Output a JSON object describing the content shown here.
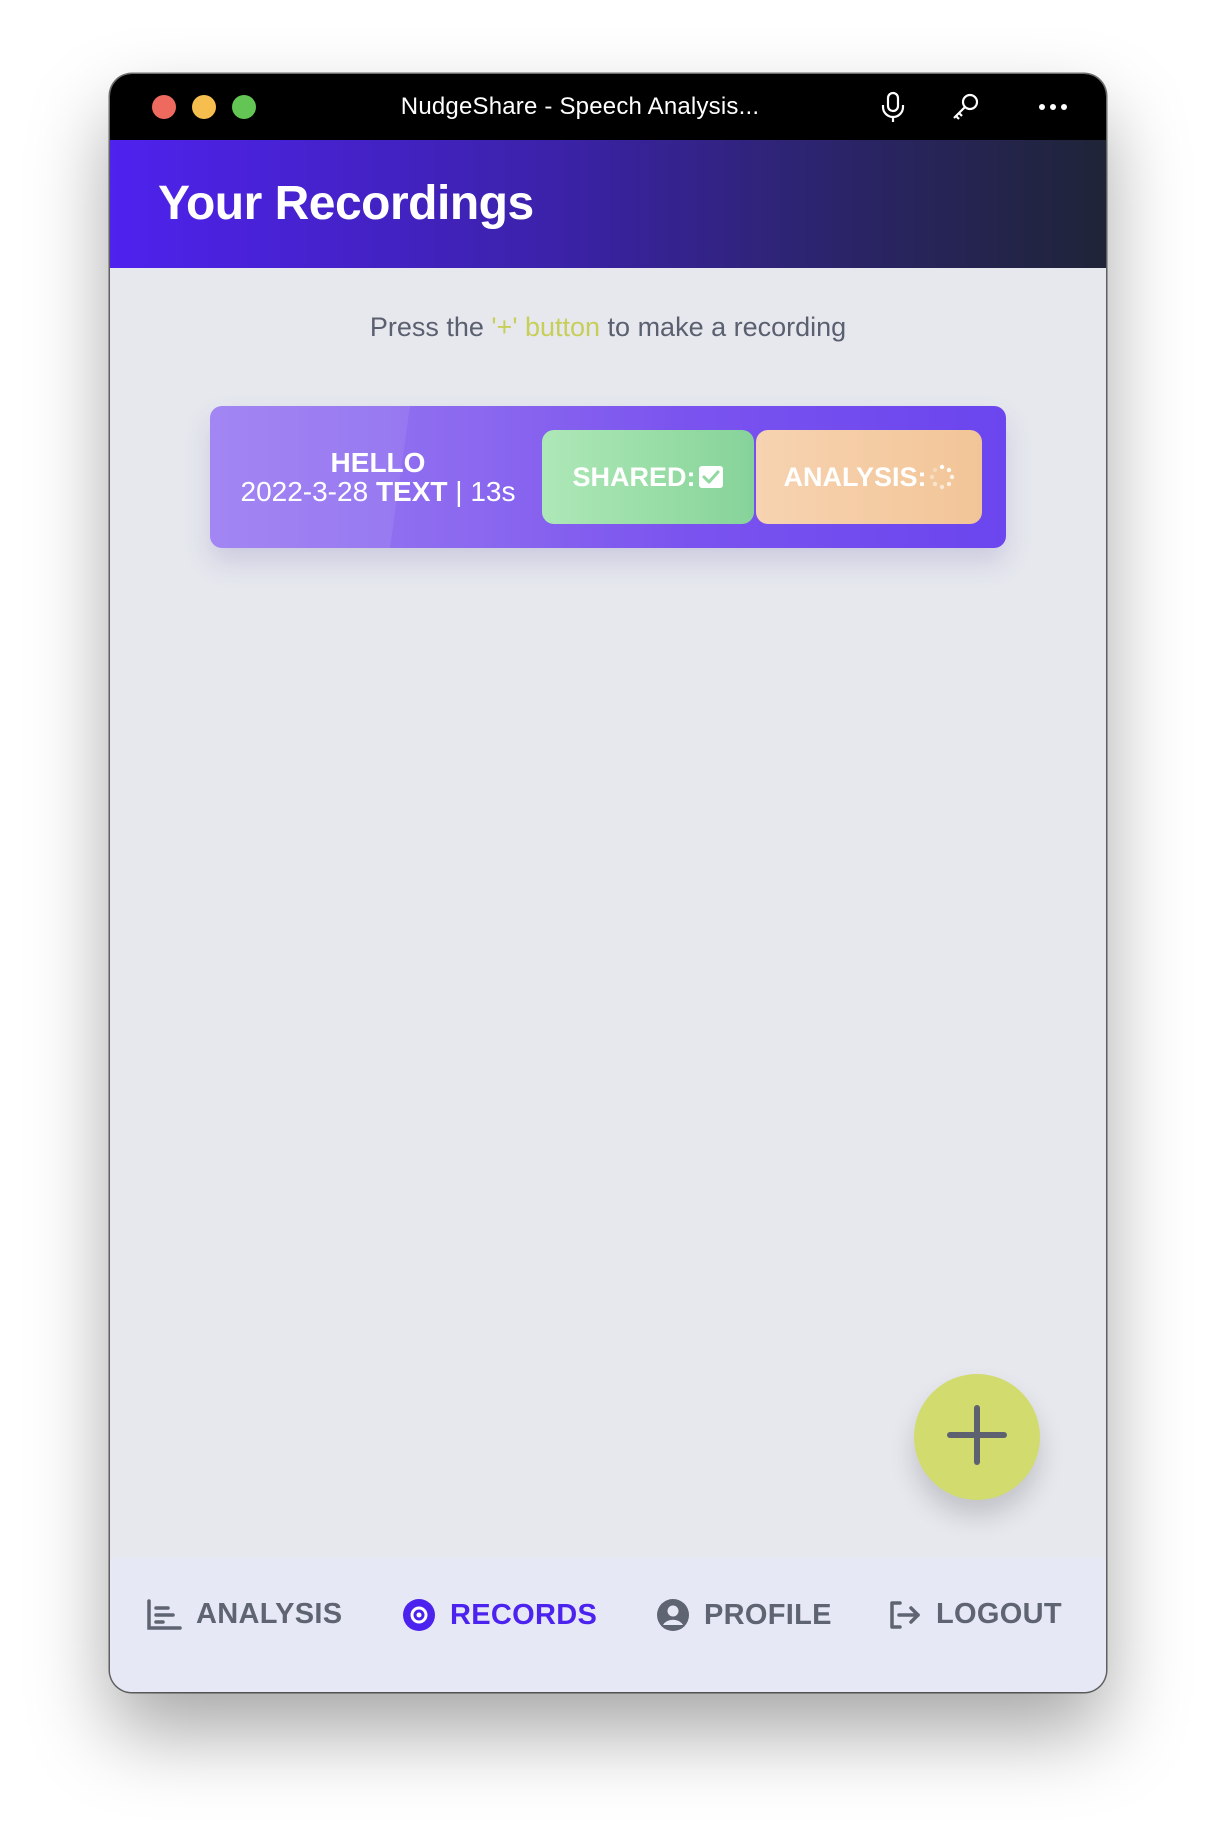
{
  "window": {
    "title": "NudgeShare - Speech Analysis..."
  },
  "header": {
    "title": "Your Recordings"
  },
  "hint": {
    "before": "Press the ",
    "accent": "'+' button",
    "after": " to make a recording"
  },
  "recordings": [
    {
      "name": "HELLO",
      "date": "2022-3-28",
      "type": "TEXT",
      "duration": "| 13s",
      "shared_label": "SHARED:",
      "shared_icon": "checkbox-checked-icon",
      "analysis_label": "ANALYSIS:",
      "analysis_icon": "loading-spinner-icon"
    }
  ],
  "fab": {
    "icon": "plus-icon"
  },
  "nav": [
    {
      "label": "ANALYSIS",
      "icon": "bar-chart-icon"
    },
    {
      "label": "RECORDS",
      "icon": "record-icon"
    },
    {
      "label": "PROFILE",
      "icon": "user-circle-icon"
    },
    {
      "label": "LOGOUT",
      "icon": "logout-icon"
    }
  ],
  "colors": {
    "brand_primary": "#4b22ee",
    "accent_yellow": "#d2db6e",
    "shared_green": "#96dca4",
    "analysis_peach": "#f2c597",
    "card_purple": "#7a53ef"
  }
}
